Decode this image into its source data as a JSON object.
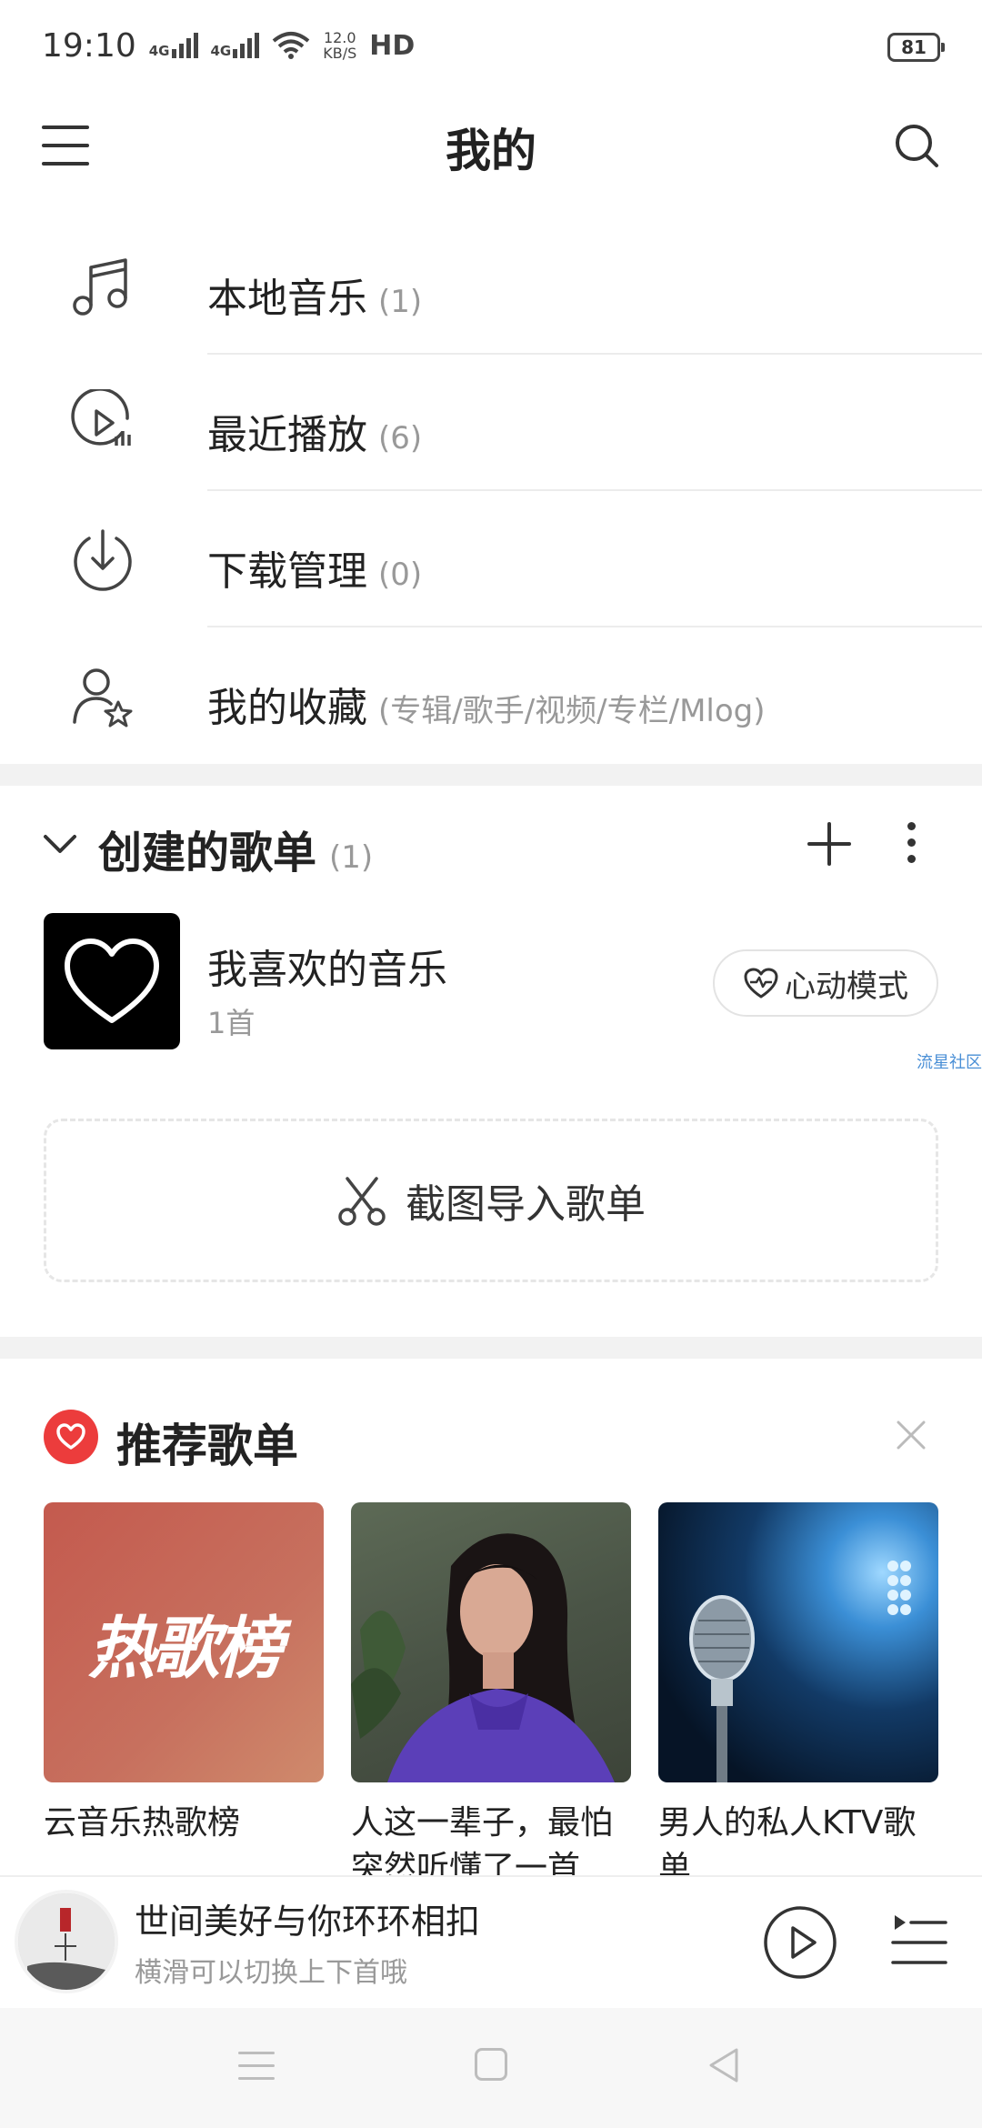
{
  "status_bar": {
    "time": "19:10",
    "sim1": "4G",
    "sim2": "4G",
    "net_speed_value": "12.0",
    "net_speed_unit": "KB/S",
    "hd": "HD",
    "battery": "81"
  },
  "header": {
    "title": "我的",
    "menu_icon": "hamburger-menu-icon",
    "search_icon": "search-icon"
  },
  "menu": {
    "items": [
      {
        "label": "本地音乐",
        "count": "(1)",
        "icon": "music-note-icon"
      },
      {
        "label": "最近播放",
        "count": "(6)",
        "icon": "recent-play-icon"
      },
      {
        "label": "下载管理",
        "count": "(0)",
        "icon": "download-icon"
      },
      {
        "label": "我的收藏",
        "count": "(专辑/歌手/视频/专栏/Mlog)",
        "icon": "user-star-icon"
      }
    ]
  },
  "created_playlists": {
    "title": "创建的歌单",
    "count": "(1)",
    "playlist": {
      "name": "我喜欢的音乐",
      "subtitle": "1首",
      "heart_mode_label": "心动模式"
    },
    "watermark": "流星社区",
    "import_label": "截图导入歌单"
  },
  "recommended": {
    "title": "推荐歌单",
    "cards": [
      {
        "title": "云音乐热歌榜",
        "cover_text": "热歌榜"
      },
      {
        "title": "人这一辈子，最怕突然听懂了一首"
      },
      {
        "title": "男人的私人KTV歌单"
      }
    ]
  },
  "player": {
    "song_title": "世间美好与你环环相扣",
    "hint": "横滑可以切换上下首哦"
  },
  "colors": {
    "accent_red": "#ec3c3c",
    "divider": "#ececec",
    "muted_text": "#999999"
  }
}
